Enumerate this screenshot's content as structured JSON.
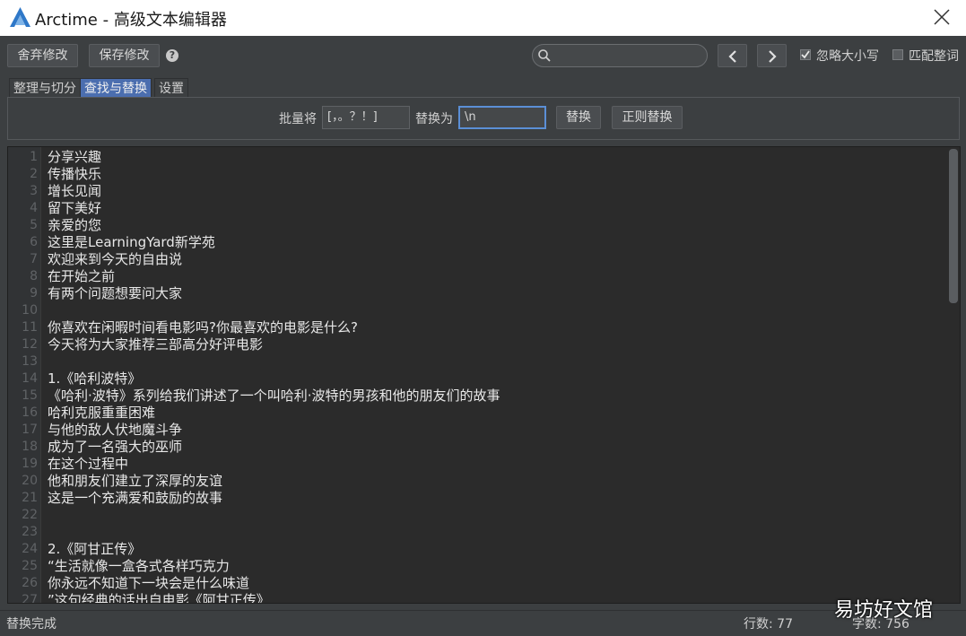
{
  "window": {
    "title": "Arctime - 高级文本编辑器"
  },
  "toolbar": {
    "discard_label": "舍弃修改",
    "save_label": "保存修改",
    "help_glyph": "?",
    "search": {
      "value": "",
      "placeholder": ""
    },
    "ignore_case": {
      "label": "忽略大小写",
      "checked": true
    },
    "whole_word": {
      "label": "匹配整词",
      "checked": false
    }
  },
  "tabs": [
    {
      "label": "整理与切分",
      "active": false
    },
    {
      "label": "查找与替换",
      "active": true
    },
    {
      "label": "设置",
      "active": false
    }
  ],
  "replace": {
    "batch_label": "批量将",
    "find_value": "[，。？！]",
    "replace_with_label": "替换为",
    "replace_value": "\\n",
    "replace_button": "替换",
    "regex_button": "正则替换"
  },
  "editor": {
    "lines": [
      "分享兴趣",
      "传播快乐",
      "增长见闻",
      "留下美好",
      "亲爱的您",
      "这里是LearningYard新学苑",
      "欢迎来到今天的自由说",
      "在开始之前",
      "有两个问题想要问大家",
      "",
      "你喜欢在闲暇时间看电影吗?你最喜欢的电影是什么?",
      "今天将为大家推荐三部高分好评电影",
      "",
      "1.《哈利波特》",
      "《哈利·波特》系列给我们讲述了一个叫哈利·波特的男孩和他的朋友们的故事",
      "哈利克服重重困难",
      "与他的敌人伏地魔斗争",
      "成为了一名强大的巫师",
      "在这个过程中",
      "他和朋友们建立了深厚的友谊",
      "这是一个充满爱和鼓励的故事",
      "",
      "",
      "2.《阿甘正传》",
      "“生活就像一盒各式各样巧克力",
      "你永远不知道下一块会是什么味道",
      "”这句经典的话出自电影《阿甘正传》"
    ]
  },
  "status": {
    "message": "替换完成",
    "line_count_label": "行数: 77",
    "char_count_label": "字数: 756"
  },
  "watermark": "易坊好文馆",
  "colors": {
    "accent": "#4b6eaf",
    "background": "#3c3f41",
    "editor_bg": "#2b2b2b"
  }
}
